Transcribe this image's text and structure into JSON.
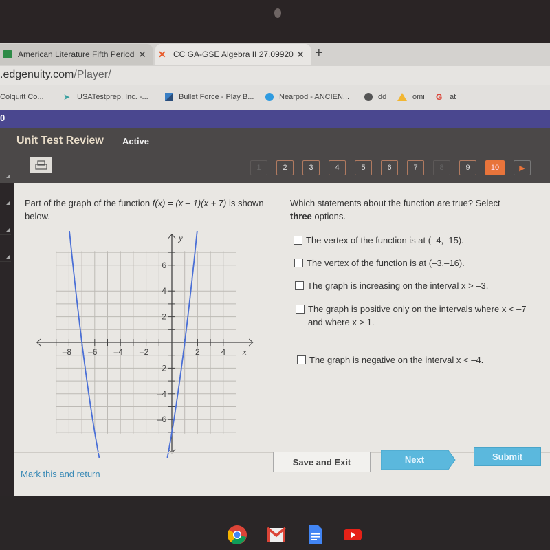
{
  "browser": {
    "tabs": [
      {
        "title": "American Literature Fifth Period",
        "icon": "classroom-icon",
        "active": false
      },
      {
        "title": "CC GA-GSE Algebra II 27.09920",
        "icon": "edgenuity-icon",
        "active": true
      }
    ],
    "new_tab_label": "+",
    "url_host": ".edgenuity.com",
    "url_path": "/Player/",
    "bookmarks": [
      {
        "label": "Colquitt Co...",
        "icon": "none"
      },
      {
        "label": "USATestprep, Inc. -...",
        "icon": "cursor-icon"
      },
      {
        "label": "Bullet Force - Play B...",
        "icon": "blocks-icon"
      },
      {
        "label": "Nearpod - ANCIEN...",
        "icon": "nearpod-icon"
      },
      {
        "label": "dd",
        "icon": "globe-icon"
      },
      {
        "label": "omi",
        "icon": "google-drive-icon"
      },
      {
        "label": "at",
        "icon": "google-icon"
      }
    ]
  },
  "app": {
    "bar_text": "0",
    "title": "Unit Test Review",
    "status": "Active",
    "pages": [
      {
        "label": "1",
        "state": "disabled"
      },
      {
        "label": "2",
        "state": "normal"
      },
      {
        "label": "3",
        "state": "normal"
      },
      {
        "label": "4",
        "state": "normal"
      },
      {
        "label": "5",
        "state": "normal"
      },
      {
        "label": "6",
        "state": "normal"
      },
      {
        "label": "7",
        "state": "normal"
      },
      {
        "label": "8",
        "state": "disabled"
      },
      {
        "label": "9",
        "state": "normal"
      },
      {
        "label": "10",
        "state": "current"
      }
    ],
    "next_page_label": "▶"
  },
  "question": {
    "prompt_prefix": "Part of the graph of the function ",
    "function_text": "f(x) = (x – 1)(x + 7)",
    "prompt_suffix": " is shown below.",
    "instruction_prefix": "Which statements about the function are true? Select ",
    "instruction_bold": "three",
    "instruction_suffix": " options.",
    "options": [
      {
        "text": "The vertex of the function is at (–4,–15).",
        "checked": false
      },
      {
        "text": "The vertex of the function is at (–3,–16).",
        "checked": false
      },
      {
        "text": "The graph is increasing on the interval x > –3.",
        "checked": false
      },
      {
        "text": "The graph is positive only on the intervals where x < –7 and where x > 1.",
        "checked": false
      },
      {
        "text": "The graph is negative on the interval x < –4.",
        "checked": false
      }
    ]
  },
  "graph": {
    "x_label": "x",
    "y_label": "y",
    "x_ticks": [
      "–8",
      "–6",
      "–4",
      "–2",
      "2",
      "4"
    ],
    "y_ticks": [
      "6",
      "4",
      "2",
      "–2",
      "–4",
      "–6"
    ],
    "curve_color": "#4a6fd6"
  },
  "footer": {
    "mark_label": "Mark this and return",
    "save_label": "Save and Exit",
    "next_label": "Next",
    "submit_label": "Submit"
  },
  "shelf": [
    "chrome-icon",
    "gmail-icon",
    "docs-icon",
    "youtube-icon"
  ]
}
